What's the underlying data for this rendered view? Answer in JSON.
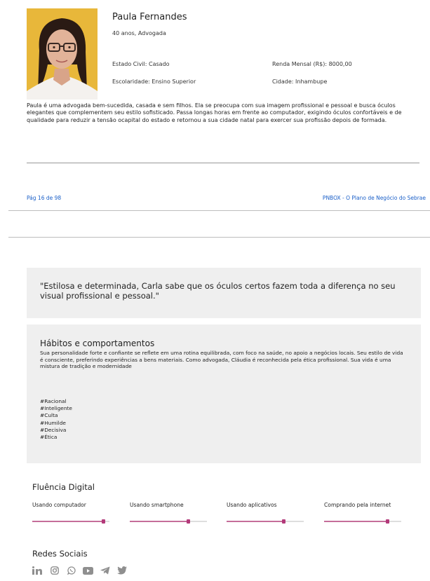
{
  "persona": {
    "name": "Paula Fernandes",
    "age_profession": "40 anos, Advogada",
    "civil_status": "Estado Civil: Casado",
    "education": "Escolaridade: Ensino Superior",
    "income": "Renda Mensal (R$): 8000,00",
    "city": "Cidade: Inhambupe",
    "description": "Paula é uma advogada bem-sucedida, casada e sem filhos. Ela se preocupa com sua imagem profissional e pessoal e busca óculos elegantes que complementem seu estilo sofisticado. Passa longas horas em frente ao computador, exigindo óculos confortáveis e de qualidade para reduzir a tensão ocapital do estado e retornou a sua cidade natal para exercer sua profissão depois de formada."
  },
  "footer": {
    "page": "Pág 16 de 98",
    "doc_title": "PNBOX - O Plano de Negócio do Sebrae"
  },
  "quote": "\"Estilosa e determinada, Carla sabe que os óculos certos fazem toda a diferença no seu visual profissional e pessoal.\"",
  "habits": {
    "title": "Hábitos e comportamentos",
    "text": "Sua personalidade forte e confiante se reflete em uma rotina equilibrada, com foco na saúde, no apoio a negócios locais. Seu estilo de vida é consciente, preferindo experiências a bens materiais. Como advogada, Cláudia é reconhecida pela ética profissional. Sua vida é uma mistura de tradição e modernidade",
    "tags": [
      "#Racional",
      "#Inteligente",
      "#Culta",
      "#Humilde",
      "#Decisiva",
      "#Ética"
    ]
  },
  "digital": {
    "title": "Fluência Digital",
    "items": [
      {
        "label": "Usando computador",
        "level": 0.92
      },
      {
        "label": "Usando smartphone",
        "level": 0.76
      },
      {
        "label": "Usando aplicativos",
        "level": 0.74
      },
      {
        "label": "Comprando pela internet",
        "level": 0.82
      }
    ]
  },
  "social": {
    "title": "Redes Sociais",
    "icons": [
      "linkedin-icon",
      "instagram-icon",
      "whatsapp-icon",
      "youtube-icon",
      "telegram-icon",
      "twitter-icon"
    ]
  },
  "colors": {
    "accent_link": "#1a5fc8",
    "slider_fill": "#c56e9a",
    "slider_knob": "#b33a7a",
    "photo_bg": "#e8b73a",
    "box_bg": "#efefef",
    "icon_gray": "#8f8f8f"
  }
}
